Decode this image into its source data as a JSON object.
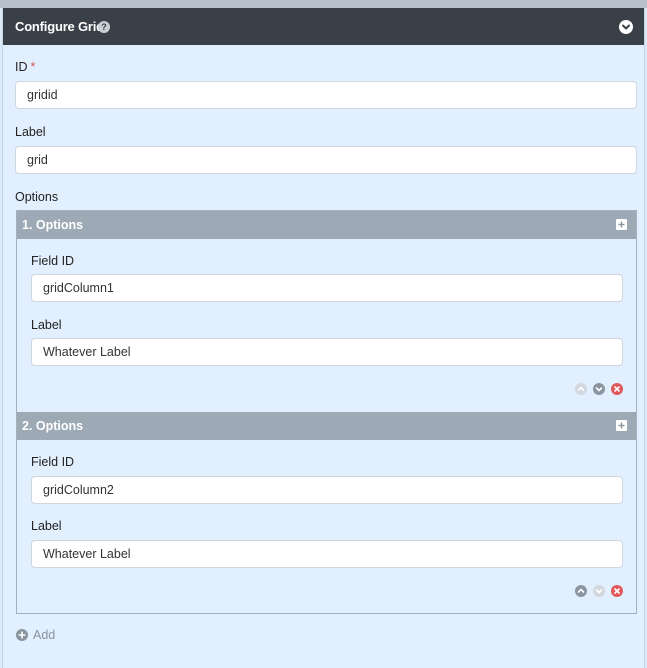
{
  "header": {
    "title": "Configure Grid",
    "help_icon": "question-circle-icon",
    "collapse_icon": "chevron-down-circle-icon"
  },
  "form": {
    "id_label": "ID",
    "id_required_mark": "*",
    "id_value": "gridid",
    "label_label": "Label",
    "label_value": "grid",
    "options_label": "Options"
  },
  "options": [
    {
      "title": "1. Options",
      "field_id_label": "Field ID",
      "field_id_value": "gridColumn1",
      "label_label": "Label",
      "label_value": "Whatever Label",
      "move_up_enabled": false,
      "move_down_enabled": true
    },
    {
      "title": "2. Options",
      "field_id_label": "Field ID",
      "field_id_value": "gridColumn2",
      "label_label": "Label",
      "label_value": "Whatever Label",
      "move_up_enabled": true,
      "move_down_enabled": false
    }
  ],
  "add": {
    "label": "Add",
    "icon": "plus-circle-icon"
  },
  "colors": {
    "header_bg": "#3a4047",
    "option_header_bg": "#9daab6",
    "panel_bg": "#e2efff",
    "required": "#d9534f",
    "remove": "#e0575b"
  }
}
